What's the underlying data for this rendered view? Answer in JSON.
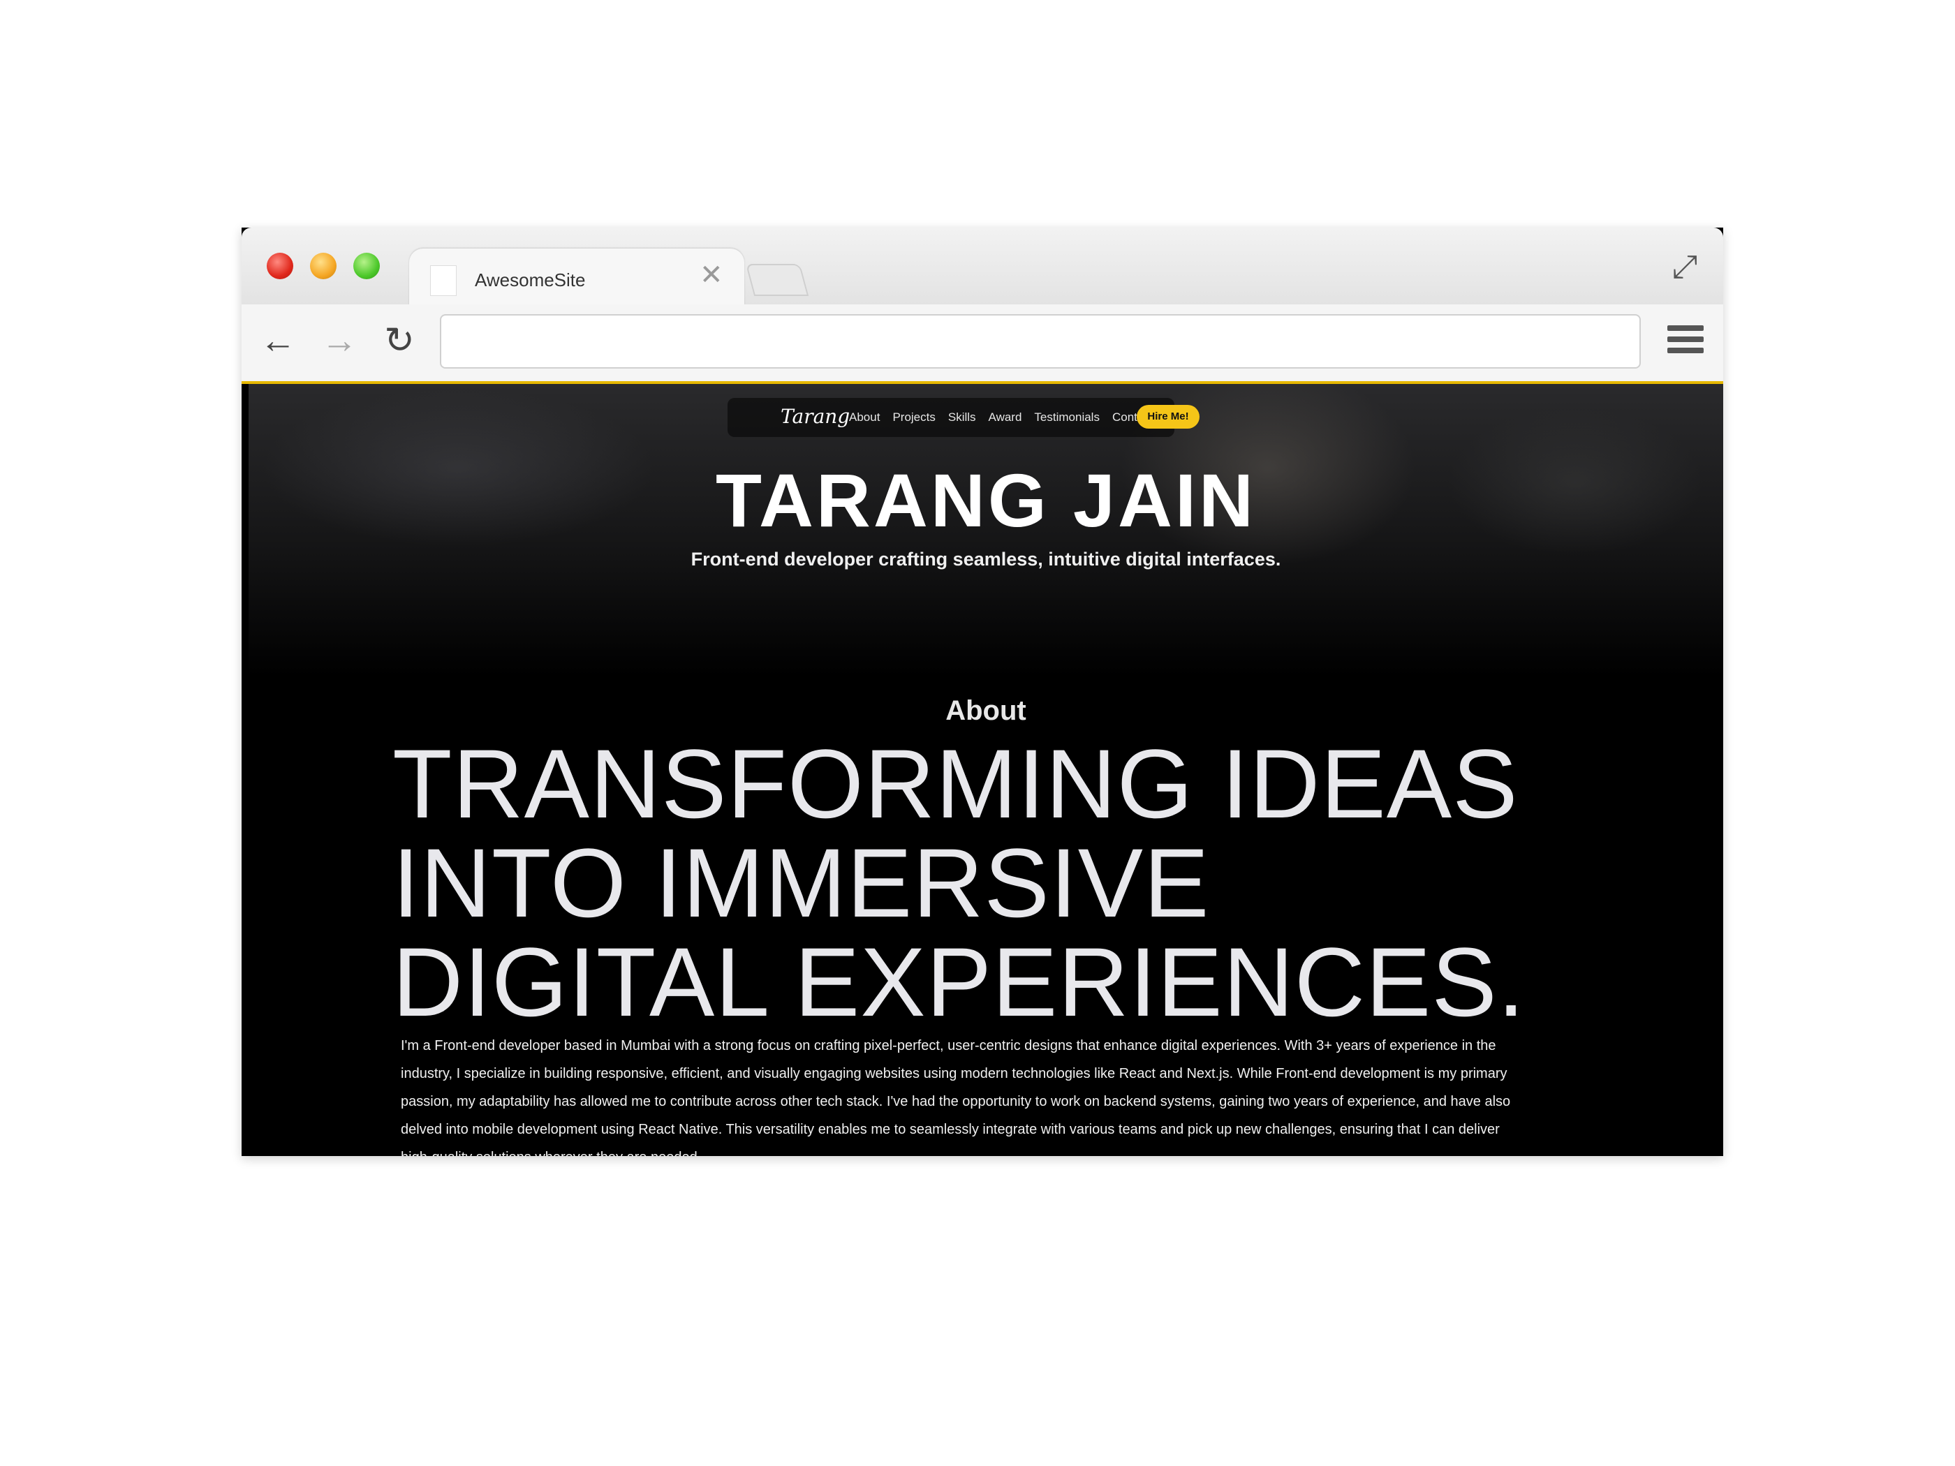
{
  "browser": {
    "tab_title": "AwesomeSite",
    "tab_close": "✕",
    "url": ""
  },
  "site": {
    "logo": "Tarang",
    "nav": [
      "About",
      "Projects",
      "Skills",
      "Award",
      "Testimonials",
      "Contact"
    ],
    "cta": "Hire Me!",
    "accent_color": "#f5c518"
  },
  "hero": {
    "title": "TARANG JAIN",
    "subtitle": "Front-end developer crafting seamless, intuitive digital interfaces."
  },
  "about": {
    "label": "About",
    "headline_lines": [
      "TRANSFORMING IDEAS",
      "INTO IMMERSIVE",
      "DIGITAL EXPERIENCES."
    ],
    "body": "I'm a Front-end developer based in Mumbai with a strong focus on crafting pixel-perfect, user-centric designs that enhance digital experiences. With 3+ years of experience in the industry, I specialize in building responsive, efficient, and visually engaging websites using modern technologies like React and Next.js. While Front-end development is my primary passion, my adaptability has allowed me to contribute across other tech stack. I've had the opportunity to work on backend systems, gaining two years of experience, and have also delved into mobile development using React Native. This versatility enables me to seamlessly integrate with various teams and pick up new challenges, ensuring that I can deliver high-quality solutions wherever they are needed."
  }
}
